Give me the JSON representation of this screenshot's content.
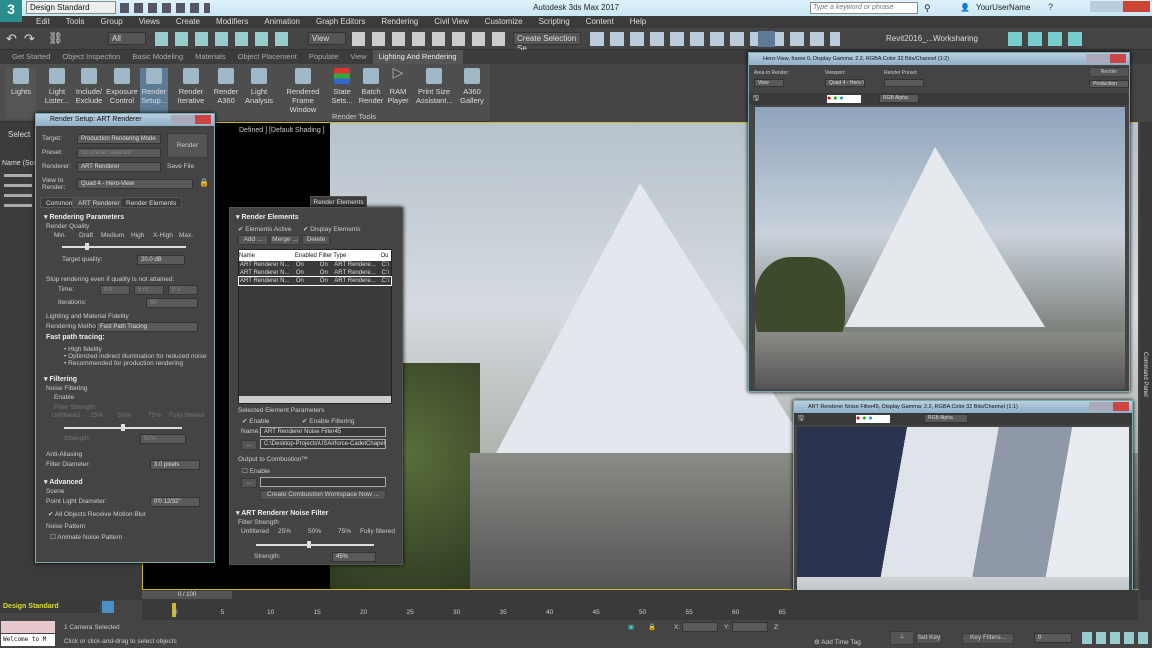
{
  "app": {
    "title": "Autodesk 3ds Max 2017",
    "logo": "3",
    "logo_sub": "MAX",
    "workspace": "Design Standard",
    "search_placeholder": "Type a keyword or phrase",
    "user": "YourUserName"
  },
  "menu": [
    "Edit",
    "Tools",
    "Group",
    "Views",
    "Create",
    "Modifiers",
    "Animation",
    "Graph Editors",
    "Rendering",
    "Civil View",
    "Customize",
    "Scripting",
    "Content",
    "Help"
  ],
  "toolbar": {
    "filter": "All",
    "ref_coord": "View",
    "selection_set": "Create Selection Se",
    "project": "Revit2016_...Worksharing"
  },
  "ribbon": {
    "tabs": [
      "Get Started",
      "Object Inspection",
      "Basic Modeling",
      "Materials",
      "Object Placement",
      "Populate",
      "View",
      "Lighting And Rendering"
    ],
    "active_tab": "Lighting And Rendering",
    "buttons": [
      "Lights",
      "Light Lister...",
      "Include/ Exclude",
      "Exposure Control",
      "Render Setup...",
      "Render Iterative",
      "Render A360",
      "Light Analysis",
      "Rendered Frame Window",
      "State Sets...",
      "Batch Render",
      "RAM Player",
      "Print Size Assistant...",
      "A360 Gallery"
    ],
    "group_label": "Render Tools"
  },
  "scene_explorer": {
    "select_label": "Select",
    "name_header": "Name (Sort"
  },
  "viewport": {
    "label": "Defined ] [Default Shading ]"
  },
  "render_setup": {
    "title": "Render Setup: ART Renderer",
    "target_label": "Target:",
    "target": "Production Rendering Mode",
    "preset_label": "Preset:",
    "preset": "No preset selected",
    "renderer_label": "Renderer:",
    "renderer": "ART Renderer",
    "save_file": "Save File",
    "view_label": "View to Render:",
    "view": "Quad 4 - Hero-View",
    "render_btn": "Render",
    "tabs": [
      "Common",
      "ART Renderer",
      "Render Elements"
    ],
    "rendering_parameters": "Rendering Parameters",
    "render_quality": "Render Quality",
    "quality_ticks": [
      "Min.",
      "Draft",
      "Medium",
      "High",
      "X-High",
      "Max."
    ],
    "target_quality_label": "Target quality:",
    "target_quality": "20.0 dB",
    "stop_label": "Stop rendering even if quality is not attained:",
    "time_label": "Time:",
    "time_h": "0 h",
    "time_m": "5 m",
    "time_s": "0 s",
    "iterations_label": "Iterations:",
    "iterations": "50",
    "fidelity_label": "Lighting and Material Fidelity",
    "method_label": "Rendering Method:",
    "method": "Fast Path Tracing",
    "fpt_title": "Fast path tracing:",
    "fpt_bullets": [
      "High fidelity",
      "Optimized indirect illumination for reduced noise",
      "Recommended for production rendering"
    ],
    "filtering": "Filtering",
    "noise_filtering": "Noise Filtering",
    "enable": "Enable",
    "filter_strength": "Filter Strength:",
    "strength_ticks": [
      "Unfiltered",
      "25%",
      "50%",
      "75%",
      "Fully filtered"
    ],
    "strength_label": "Strength:",
    "strength": "50%",
    "anti_aliasing": "Anti-Aliasing",
    "filter_diameter_label": "Filter Diameter:",
    "filter_diameter": "3.0 pixels",
    "advanced": "Advanced",
    "scene": "Scene",
    "point_light_label": "Point Light Diameter:",
    "point_light": "0'0 12/32\"",
    "motion_blur": "All Objects Receive Motion Blur",
    "noise_pattern": "Noise Pattern",
    "animate_noise": "Animate Noise Pattern"
  },
  "render_elements": {
    "tab": "Render Elements",
    "section": "Render Elements",
    "elements_active": "Elements Active",
    "display_elements": "Display Elements",
    "add": "Add ...",
    "merge": "Merge ...",
    "delete": "Delete",
    "columns": [
      "Name",
      "Enabled",
      "Filter",
      "Type",
      "Ou"
    ],
    "rows": [
      [
        "ART Renderer N...",
        "On",
        "On",
        "ART Rendere...",
        "C:\\"
      ],
      [
        "ART Renderer N...",
        "On",
        "On",
        "ART Rendere...",
        "C:\\"
      ],
      [
        "ART Renderer N...",
        "On",
        "On",
        "ART Rendere...",
        "C:\\"
      ]
    ],
    "selected_params": "Selected Element Parameters",
    "enable": "Enable",
    "enable_filtering": "Enable Filtering",
    "name_label": "Name:",
    "name": "ART Renderer Noise Filter45",
    "path": "C:\\Desktop-Projects\\USAirforce-CadetChapel\\USA",
    "browse": "...",
    "combustion": "Output to Combustion™",
    "combustion_enable": "Enable",
    "create_combustion": "Create Combustion Workspace Now ...",
    "noise_filter": "ART Renderer Noise Filter",
    "filter_strength": "Filter Strength",
    "ticks": [
      "Unfiltered",
      "25%",
      "50%",
      "75%",
      "Fully filtered"
    ],
    "strength_label": "Strength:",
    "strength": "45%"
  },
  "frame_window_1": {
    "title": "Hero-View, frame 0, Display Gamma: 2.2, RGBA Color 32 Bits/Channel (1:2)",
    "area_label": "Area to Render:",
    "area": "View",
    "viewport_label": "Viewport:",
    "viewport": "Quad 4 - Hero-Vie",
    "preset_label": "Render Preset:",
    "render_btn": "Render",
    "mode": "Production",
    "channel": "RGB Alpha"
  },
  "frame_window_2": {
    "title": "ART Renderer Noise Filter45, Display Gamma: 2.2, RGBA Color 32 Bits/Channel (1:1)",
    "channel": "RGB Alpha"
  },
  "command_panel": "Command Panel",
  "timeline": {
    "frame": "0 / 100",
    "ticks": [
      "0",
      "5",
      "10",
      "15",
      "20",
      "25",
      "30",
      "35",
      "40",
      "45",
      "50",
      "55",
      "60",
      "65"
    ]
  },
  "status": {
    "workspace": "Design Standard",
    "maxscript": "Welcome to M",
    "selected": "1 Camera Selected",
    "prompt": "Click or click-and-drag to select objects",
    "x_label": "X:",
    "y_label": "Y:",
    "z_label": "Z:",
    "add_time_tag": "Add Time Tag",
    "set_key": "Set Key",
    "key_filters": "Key Filters...",
    "frame_field": "0"
  }
}
